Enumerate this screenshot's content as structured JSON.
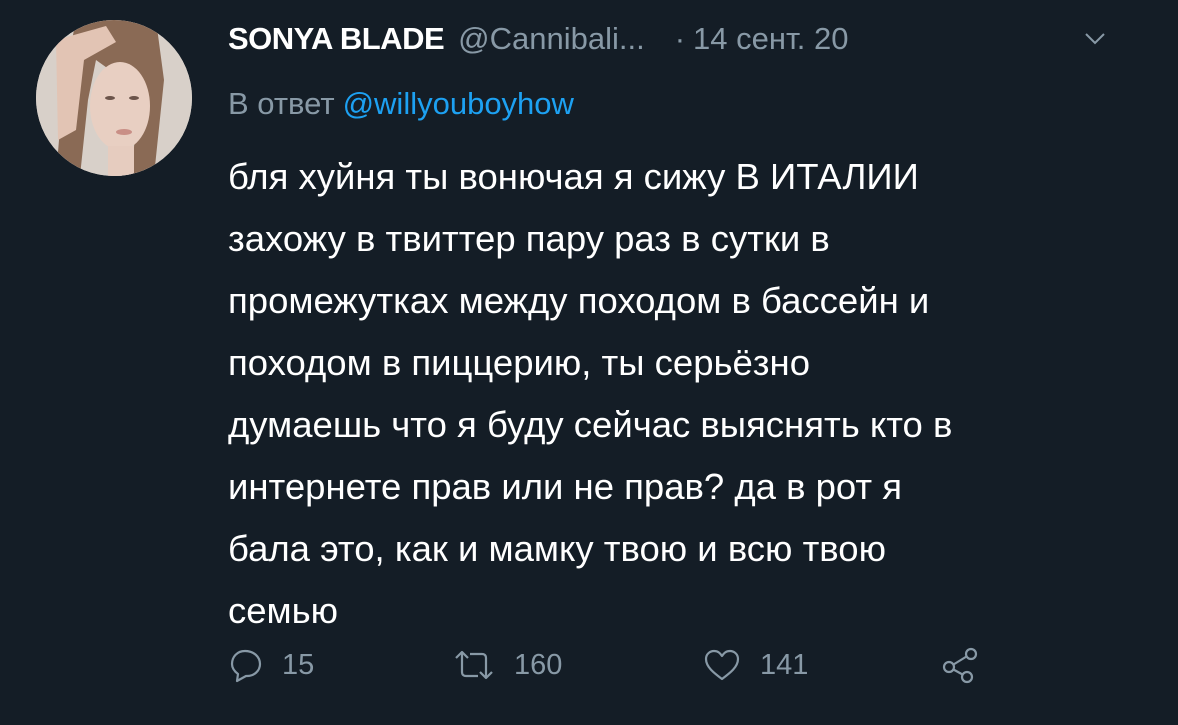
{
  "tweet": {
    "display_name": "SONYA BLADE",
    "handle": "@Cannibali...",
    "separator": "·",
    "date": "14 сент. 20",
    "reply_prefix": "В ответ",
    "reply_mention": "@willyouboyhow",
    "text": "бля хуйня ты вонючая я сижу В ИТАЛИИ\nзахожу в твиттер пару раз в сутки в\nпромежутках между походом в бассейн и\nпоходом в пиццерию, ты серьёзно\nдумаешь что я буду сейчас выяснять кто в\nинтернете прав или не прав? да в рот я\nбала это, как и мамку твою и всю твою\nсемью"
  },
  "actions": {
    "reply_count": "15",
    "retweet_count": "160",
    "like_count": "141"
  },
  "icons": {
    "reply": "reply-icon",
    "retweet": "retweet-icon",
    "like": "heart-icon",
    "share": "share-icon",
    "caret": "chevron-down-icon"
  },
  "colors": {
    "background": "#141d26",
    "secondary_text": "#8899a6",
    "link": "#1da1f2",
    "primary_text": "#ffffff"
  }
}
